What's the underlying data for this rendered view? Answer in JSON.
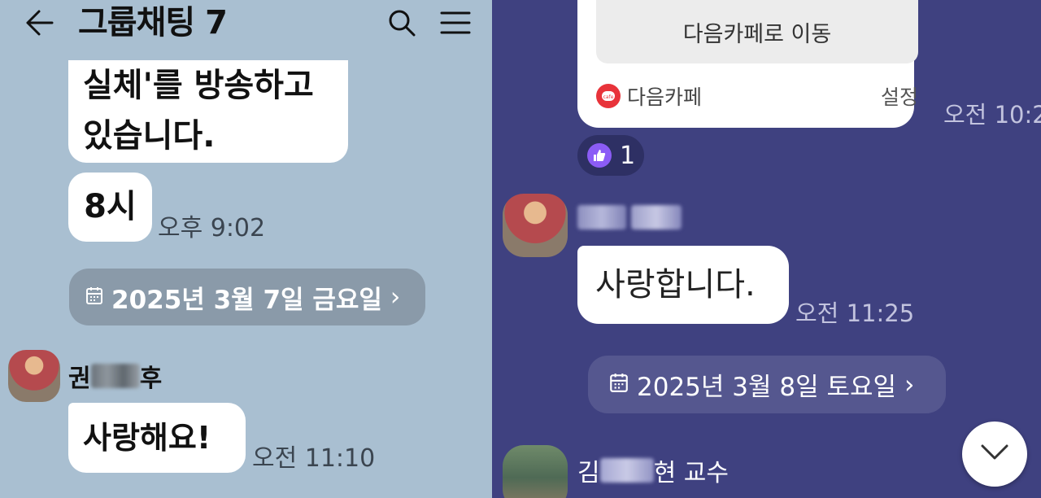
{
  "left": {
    "header": {
      "title": "그룹채팅 7",
      "back_icon": "arrow-left-icon",
      "search_icon": "search-icon",
      "menu_icon": "hamburger-menu-icon"
    },
    "messages": [
      {
        "text_line1": "실체'를 방송하고",
        "text_line2": "있습니다."
      },
      {
        "text": "8시",
        "time": "오후 9:02"
      }
    ],
    "date_divider": {
      "label": "2025년 3월 7일 금요일",
      "chevron": "›",
      "icon": "calendar-icon"
    },
    "sender_message": {
      "name_visible": "권",
      "name_visible_end": "후",
      "text": "사랑해요!",
      "time": "오전 11:10"
    }
  },
  "right": {
    "card": {
      "button_label": "다음카페로 이동",
      "source_name": "다음카페",
      "settings_label": "설정",
      "time": "오전 10:2",
      "logo_text": "cafe"
    },
    "reaction": {
      "icon": "thumbs-up-icon",
      "count": "1"
    },
    "message1": {
      "text": "사랑합니다.",
      "time": "오전 11:25"
    },
    "date_divider": {
      "label": "2025년 3월 8일 토요일",
      "chevron": "›",
      "icon": "calendar-icon"
    },
    "sender2": {
      "name_visible_start": "김",
      "name_visible_end": "현 교수"
    },
    "scroll_down_icon": "chevron-down-icon"
  },
  "colors": {
    "left_bg": "#a9bfd1",
    "right_bg": "#3f4180",
    "date_left_bg": "#8a9aa9",
    "date_right_bg": "#55578f"
  }
}
